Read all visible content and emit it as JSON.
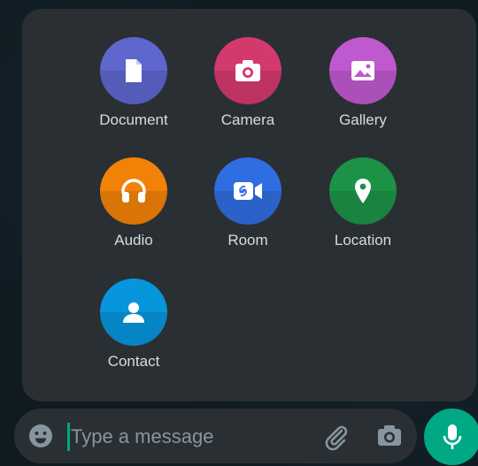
{
  "attach_menu": {
    "items": [
      {
        "label": "Document",
        "icon": "document-icon",
        "color": "#5f66cd"
      },
      {
        "label": "Camera",
        "icon": "camera-icon",
        "color": "#d3396d"
      },
      {
        "label": "Gallery",
        "icon": "gallery-icon",
        "color": "#bf59cf"
      },
      {
        "label": "Audio",
        "icon": "headphones-icon",
        "color": "#f28207"
      },
      {
        "label": "Room",
        "icon": "video-room-icon",
        "color": "#2f6ee0"
      },
      {
        "label": "Location",
        "icon": "location-pin-icon",
        "color": "#1c9247"
      },
      {
        "label": "Contact",
        "icon": "contact-icon",
        "color": "#0795dc"
      }
    ]
  },
  "composer": {
    "placeholder": "Type a message",
    "emoji_icon": "emoji-icon",
    "attach_icon": "paperclip-icon",
    "camera_icon": "camera-icon",
    "mic_icon": "mic-icon",
    "mic_color": "#00a884"
  }
}
